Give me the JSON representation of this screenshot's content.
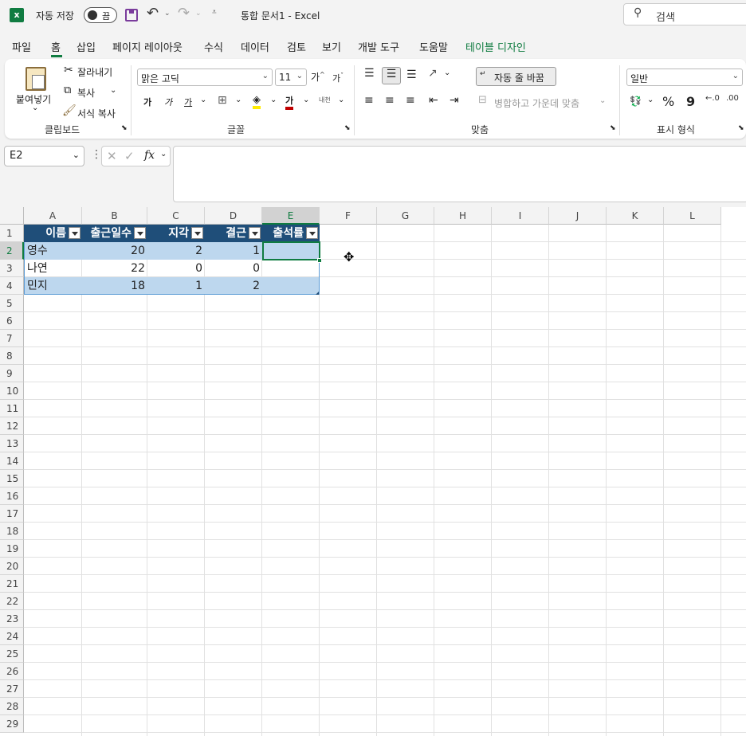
{
  "titlebar": {
    "autosave_label": "자동 저장",
    "toggle_state": "끔",
    "doc_title": "통합 문서1 - Excel",
    "search_placeholder": "검색"
  },
  "menu": [
    "파일",
    "홈",
    "삽입",
    "페이지 레이아웃",
    "수식",
    "데이터",
    "검토",
    "보기",
    "개발 도구",
    "도움말",
    "테이블 디자인"
  ],
  "ribbon": {
    "clipboard": {
      "paste": "붙여넣기",
      "cut": "잘라내기",
      "copy": "복사",
      "format_painter": "서식 복사",
      "label": "클립보드"
    },
    "font": {
      "name": "맑은 고딕",
      "size": "11",
      "bold": "가",
      "italic": "가",
      "underline": "가",
      "color_glyph": "가",
      "phonetic": "내천",
      "label": "글꼴"
    },
    "alignment": {
      "wrap": "자동 줄 바꿈",
      "merge": "병합하고 가운데 맞춤",
      "label": "맞춤"
    },
    "number": {
      "format": "일반",
      "percent": "%",
      "comma": "9",
      "label": "표시 형식"
    }
  },
  "formula": {
    "namebox": "E2",
    "fx": "fx",
    "value": ""
  },
  "columns": [
    "A",
    "B",
    "C",
    "D",
    "E",
    "F",
    "G",
    "H",
    "I",
    "J",
    "K",
    "L"
  ],
  "rows": [
    "1",
    "2",
    "3",
    "4",
    "5",
    "6",
    "7",
    "8",
    "9",
    "10",
    "11",
    "12",
    "13",
    "14",
    "15",
    "16",
    "17",
    "18",
    "19",
    "20",
    "21",
    "22",
    "23",
    "24",
    "25",
    "26",
    "27",
    "28",
    "29"
  ],
  "table": {
    "headers": [
      "이름",
      "출근일수",
      "지각",
      "결근",
      "출석률"
    ],
    "rows": [
      [
        "영수",
        "20",
        "2",
        "1",
        ""
      ],
      [
        "나연",
        "22",
        "0",
        "0",
        ""
      ],
      [
        "민지",
        "18",
        "1",
        "2",
        ""
      ]
    ]
  },
  "colors": {
    "header_bg": "#1f4e79",
    "band": "#bdd7ee",
    "accent": "#217346",
    "selection": "#107c41"
  }
}
